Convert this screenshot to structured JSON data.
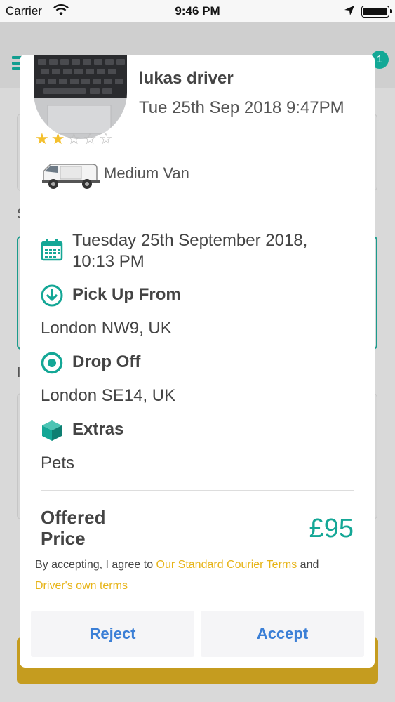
{
  "status_bar": {
    "carrier": "Carrier",
    "time": "9:46 PM"
  },
  "background": {
    "badge_count": "1",
    "section_letter_1": "S",
    "section_letter_2": "I"
  },
  "modal": {
    "driver_name": "lukas driver",
    "driver_date": "Tue 25th Sep 2018 9:47PM",
    "rating": {
      "value": 2,
      "max": 5
    },
    "vehicle": "Medium Van",
    "date_line1": "Tuesday 25th September 2018,",
    "date_line2": "10:13 PM",
    "pickup_label": "Pick Up From",
    "pickup_value": "London NW9, UK",
    "dropoff_label": "Drop Off",
    "dropoff_value": "London SE14, UK",
    "extras_label": "Extras",
    "extras_value": "Pets",
    "offered_line1": "Offered",
    "offered_line2": "Price",
    "price": "£95",
    "terms_prefix": "By accepting, I agree to ",
    "terms_link1": "Our Standard Courier Terms",
    "terms_and": " and",
    "terms_link2": "Driver's own terms",
    "reject_label": "Reject",
    "accept_label": "Accept"
  },
  "colors": {
    "accent": "#14a796",
    "link": "#e7b418",
    "button_text": "#3b7fd6",
    "star": "#f4c02e"
  }
}
